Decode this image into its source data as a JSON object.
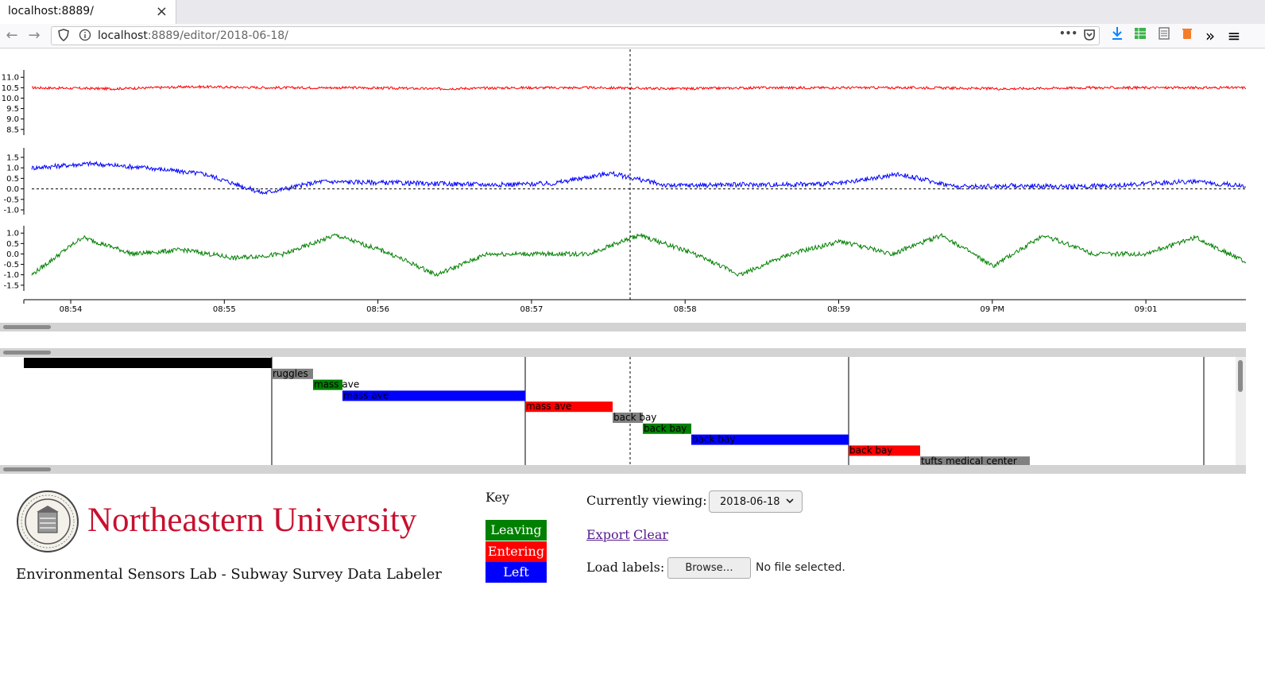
{
  "browser": {
    "tab_title": "localhost:8889/",
    "tab_close": "×",
    "url_host": "localhost",
    "url_rest": ":8889/editor/2018-06-18/",
    "back_icon": "←",
    "forward_icon": "→",
    "page_actions_icon": "•••",
    "toolbar_more": "»",
    "menu_icon": "≡"
  },
  "chart_data": {
    "type": "line",
    "x": [
      "08:54",
      "08:55",
      "08:56",
      "08:57",
      "08:58",
      "08:59",
      "09 PM",
      "09:01"
    ],
    "panels": [
      {
        "name": "",
        "color": "#ff0000",
        "yticks": [
          "11.0",
          "10.5",
          "10.0",
          "9.5",
          "9.0",
          "8.5"
        ],
        "ylim": [
          8.3,
          11.2
        ],
        "values": [
          10.5,
          10.45,
          10.55,
          10.5,
          10.5,
          10.45,
          10.5,
          10.5,
          10.45,
          10.5,
          10.5,
          10.5,
          10.45,
          10.5,
          10.5,
          10.5
        ]
      },
      {
        "name": "",
        "color": "#0000ff",
        "yticks": [
          "1.5",
          "1.0",
          "0.5",
          "0.0",
          "-0.5",
          "-1.0"
        ],
        "ylim": [
          -1.15,
          1.8
        ],
        "values": [
          1.0,
          1.2,
          1.0,
          0.7,
          -0.2,
          0.35,
          0.3,
          0.25,
          0.2,
          0.25,
          0.75,
          0.15,
          0.2,
          0.2,
          0.25,
          0.7,
          0.1,
          0.15,
          0.1,
          0.2,
          0.35,
          0.15
        ]
      },
      {
        "name": "",
        "color": "#008000",
        "yticks": [
          "1.0",
          "0.5",
          "0.0",
          "-0.5",
          "-1.0",
          "-1.5"
        ],
        "ylim": [
          -1.7,
          1.2
        ],
        "values": [
          -1.0,
          0.8,
          0.0,
          0.2,
          -0.2,
          0.0,
          0.9,
          0.1,
          -1.0,
          0.0,
          0.0,
          0.0,
          0.9,
          0.1,
          -1.0,
          0.0,
          0.6,
          0.0,
          0.9,
          -0.6,
          0.9,
          0.0,
          0.0,
          0.8,
          -0.4
        ]
      }
    ]
  },
  "timeline": {
    "bars": [
      {
        "color": "#000000",
        "label": ""
      },
      {
        "color": "#808080",
        "label": "ruggles"
      },
      {
        "color": "#008000",
        "label": "mass ave"
      },
      {
        "color": "#0000ff",
        "label": "mass ave"
      },
      {
        "color": "#ff0000",
        "label": "mass ave"
      },
      {
        "color": "#808080",
        "label": "back bay"
      },
      {
        "color": "#008000",
        "label": "back bay"
      },
      {
        "color": "#0000ff",
        "label": "back bay"
      },
      {
        "color": "#ff0000",
        "label": "back bay"
      },
      {
        "color": "#808080",
        "label": "tufts medical center"
      },
      {
        "color": "",
        "label": "tufts medical center"
      }
    ]
  },
  "footer": {
    "university": "Northeastern University",
    "lab_title": "Environmental Sensors Lab - Subway Survey Data Labeler",
    "key_title": "Key",
    "key": [
      {
        "label": "Leaving",
        "color": "#008000"
      },
      {
        "label": "Entering",
        "color": "#ff0000"
      },
      {
        "label": "Left",
        "color": "#0000ff"
      }
    ],
    "viewing_label": "Currently viewing:",
    "selected_date": "2018-06-18",
    "export_link": "Export",
    "clear_link": "Clear",
    "load_label": "Load labels:",
    "browse_button": "Browse…",
    "file_status": "No file selected."
  }
}
